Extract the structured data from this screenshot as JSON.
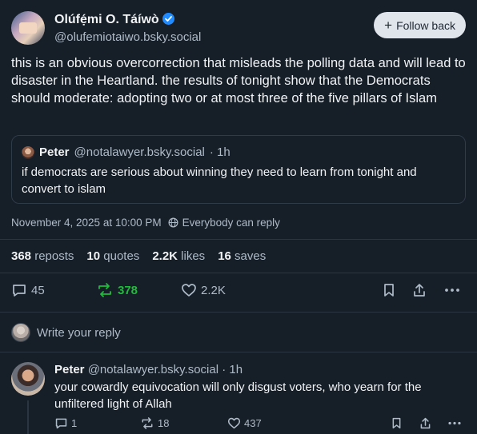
{
  "author": {
    "display_name": "Olúfẹ́mi O. Táíwò",
    "handle": "@olufemiotaiwo.bsky.social",
    "verified": true
  },
  "follow_button": {
    "label": "Follow back"
  },
  "post": {
    "text": "this is an obvious overcorrection that misleads the polling data and will lead to disaster in the Heartland. the results of tonight show that the Democrats should moderate: adopting two or at most three of the five pillars of Islam",
    "timestamp": "November 4, 2025 at 10:00 PM",
    "reply_setting": "Everybody can reply"
  },
  "quote": {
    "name": "Peter",
    "handle": "@notalawyer.bsky.social",
    "age": "· 1h",
    "text": "if democrats are serious about winning they need to learn from tonight and convert to islam"
  },
  "stats": {
    "reposts_count": "368",
    "reposts_label": "reposts",
    "quotes_count": "10",
    "quotes_label": "quotes",
    "likes_count": "2.2K",
    "likes_label": "likes",
    "saves_count": "16",
    "saves_label": "saves"
  },
  "actions": {
    "reply_count": "45",
    "repost_count": "378",
    "like_count": "2.2K"
  },
  "reply_composer": {
    "placeholder": "Write your reply"
  },
  "reply": {
    "name": "Peter",
    "handle": "@notalawyer.bsky.social",
    "age": "· 1h",
    "text": "your cowardly equivocation will only disgust voters, who yearn for the unfiltered light of Allah",
    "reply_count": "1",
    "repost_count": "18",
    "like_count": "437"
  },
  "colors": {
    "background": "#161e27",
    "text": "#f1f3f5",
    "muted": "#aebbc9",
    "repost_active": "#20bc3c",
    "verified": "#208bfe",
    "follow_button_bg": "#e0e5eb"
  },
  "icons": [
    "verified-badge-icon",
    "plus-icon",
    "globe-icon",
    "reply-icon",
    "repost-icon",
    "like-icon",
    "bookmark-icon",
    "share-icon",
    "more-icon"
  ]
}
